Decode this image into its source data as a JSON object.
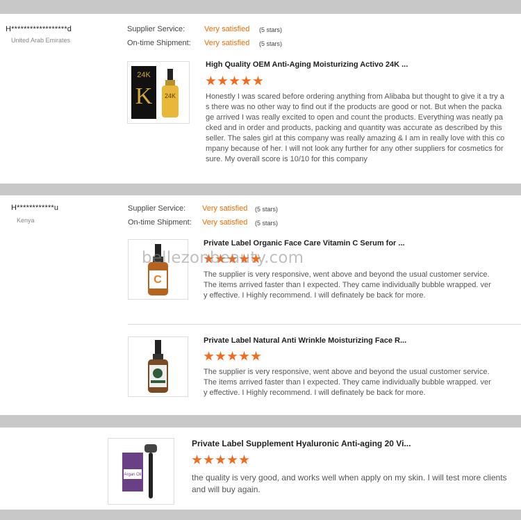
{
  "reviews": [
    {
      "reviewer": "H******************d",
      "country": "United Arab Emirates",
      "supplier_service_label": "Supplier Service:",
      "supplier_service_value": "Very satisfied",
      "supplier_service_stars": "(5 stars)",
      "shipment_label": "On-time Shipment:",
      "shipment_value": "Very satisfied",
      "shipment_stars": "(5 stars)",
      "products": [
        {
          "title": "High Quality OEM Anti-Aging Moisturizing Activo 24K ...",
          "rating": 5,
          "text": "Honestly I was scared before ordering anything from Alibaba but thought to give it a try as there was no other way to find out if the products are good or not. But when the package arrived I was really excited to open and count the products. Everything was neatly packed and in order and products, packing and quantity was accurate as described by this seller. The sales girl at this company was really amazing & I am in really love with this company because of her. I will not look any further for any other suppliers for cosmetics for sure. My overall score is 10/10 for this company",
          "image_labels": [
            "24K",
            "24K"
          ]
        }
      ]
    },
    {
      "reviewer": "H************u",
      "country": "Kenya",
      "supplier_service_label": "Supplier Service:",
      "supplier_service_value": "Very satisfied",
      "supplier_service_stars": "(5 stars)",
      "shipment_label": "On-time Shipment:",
      "shipment_value": "Very satisfied",
      "shipment_stars": "(5 stars)",
      "products": [
        {
          "title": "Private Label Organic Face Care Vitamin C Serum for ...",
          "rating": 5,
          "text": "The supplier is very responsive, went above and beyond the usual customer service. The items arrived faster than I expected. They came individually bubble wrapped. very effective. I Highly recommend. I will definately be back for more.",
          "image_labels": [
            "C"
          ]
        },
        {
          "title": "Private Label Natural Anti Wrinkle Moisturizing Face R...",
          "rating": 5,
          "text": "The supplier is very responsive, went above and beyond the usual customer service. The items arrived faster than I expected. They came individually bubble wrapped. very effective. I Highly recommend. I will definately be back for more.",
          "image_labels": []
        }
      ]
    },
    {
      "products": [
        {
          "title": "Private Label Supplement Hyaluronic Anti-aging 20 Vi...",
          "rating": 5,
          "text": "the quality is very good, and works well when apply on my skin. I will test more clients and will buy again.",
          "image_labels": [
            "Argan Oil"
          ]
        }
      ]
    }
  ],
  "watermark": "bellezonbeauty.com",
  "colors": {
    "accent": "#f06b00",
    "star": "#f26a1b",
    "separator": "#c8c8c8"
  }
}
